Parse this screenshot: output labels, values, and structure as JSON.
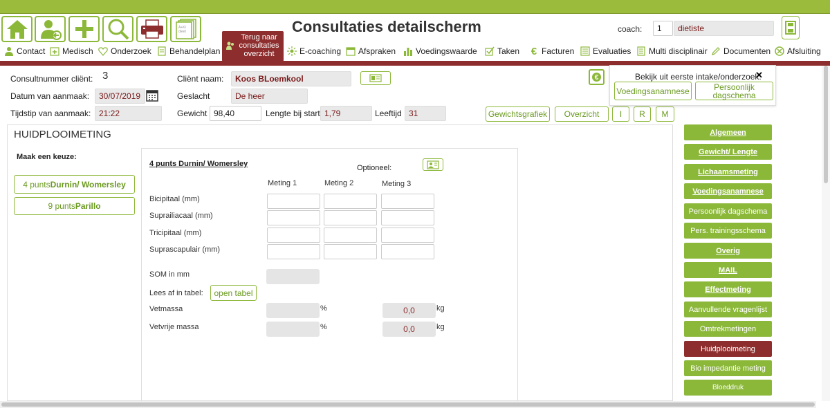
{
  "header": {
    "title": "Consultaties detailscherm",
    "coach_label": "coach:",
    "coach_id": "1",
    "coach_name": "dietiste",
    "print_card_text": "A+Kl dieet"
  },
  "nav": {
    "items": [
      {
        "label": "Contact",
        "icon": "person-icon"
      },
      {
        "label": "Medisch",
        "icon": "medical-icon"
      },
      {
        "label": "Onderzoek",
        "icon": "heart-icon"
      },
      {
        "label": "Behandelplan",
        "icon": "clipboard-icon"
      },
      {
        "label": "E-coaching",
        "icon": "sun-icon"
      },
      {
        "label": "Afspraken",
        "icon": "calendar-icon"
      },
      {
        "label": "Voedingswaarde",
        "icon": "bar-chart-icon"
      },
      {
        "label": "Taken",
        "icon": "checkbox-icon"
      },
      {
        "label": "Facturen",
        "icon": "euro-icon"
      },
      {
        "label": "Evaluaties",
        "icon": "list-icon"
      },
      {
        "label": "Multi disciplinair",
        "icon": "document-icon"
      },
      {
        "label": "Documenten",
        "icon": "pencil-icon"
      },
      {
        "label": "Afsluiting",
        "icon": "close-circle-icon"
      }
    ],
    "terug_line1": "Terug naar",
    "terug_line2": "consultaties",
    "terug_line3": "overzicht"
  },
  "client": {
    "consult_label": "Consultnummer cliënt:",
    "consult_value": "3",
    "datum_label": "Datum van aanmaak:",
    "datum_value": "30/07/2019",
    "tijd_label": "Tijdstip van aanmaak:",
    "tijd_value": "21:22",
    "naam_label": "Cliënt naam:",
    "naam_value": "Koos BLoemkool",
    "geslacht_label": "Geslacht",
    "geslacht_value": "De heer",
    "gewicht_label": "Gewicht",
    "gewicht_value": "98,40",
    "lengte_label": "Lengte bij start:",
    "lengte_value": "1,79",
    "leeftijd_label": "Leeftijd",
    "leeftijd_value": "31"
  },
  "buttons": {
    "gewichtsgrafiek": "Gewichtsgrafiek",
    "overzicht": "Overzicht",
    "i": "I",
    "r": "R",
    "m": "M"
  },
  "intake_popup": {
    "title": "Bekijk uit eerste intake/onderzoek:",
    "close": "✕",
    "btn1": "Voedingsanamnese",
    "btn2_line1": "Persoonlijk",
    "btn2_line2": "dagschema"
  },
  "section": {
    "title": "HUIDPLOOIMETING",
    "choose_label": "Maak een keuze:",
    "option1_prefix": "4 punts ",
    "option1_bold": "Durnin/ Womersley",
    "option2_prefix": "9 punts ",
    "option2_bold": "Parillo"
  },
  "form": {
    "heading": "4 punts Durnin/ Womersley",
    "optioneel": "Optioneel:",
    "col1": "Meting 1",
    "col2": "Meting 2",
    "col3": "Meting 3",
    "rows": [
      "Bicipitaal (mm)",
      "Suprailiacaal (mm)",
      "Tricipitaal (mm)",
      "Suprascapulair (mm)"
    ],
    "som_label": "SOM in mm",
    "lees_label": "Lees af in tabel:",
    "open_tabel": "open tabel",
    "vetmassa_label": "Vetmassa",
    "vetvrije_label": "Vetvrije massa",
    "pct": "%",
    "kg": "kg",
    "vetmassa_kg": "0,0",
    "vetvrije_kg": "0,0"
  },
  "sidebar": {
    "items": [
      {
        "label": "Algemeen",
        "style": "bold"
      },
      {
        "label": "Gewicht/ Lengte",
        "style": "bold"
      },
      {
        "label": "Lichaamsmeting",
        "style": "bold"
      },
      {
        "label": "Voedingsanamnese",
        "style": "bold"
      },
      {
        "label": "Persoonlijk dagschema",
        "style": "normal"
      },
      {
        "label": "Pers. trainingsschema",
        "style": "normal"
      },
      {
        "label": "Overig",
        "style": "bold"
      },
      {
        "label": "MAIL",
        "style": "bold"
      },
      {
        "label": "Effectmeting",
        "style": "bold"
      },
      {
        "label": "Aanvullende vragenlijst",
        "style": "normal"
      },
      {
        "label": "Omtrekmetingen",
        "style": "normal"
      },
      {
        "label": "Huidplooimeting",
        "style": "active"
      },
      {
        "label": "Bio impedantie meting",
        "style": "normal"
      },
      {
        "label": "Bloeddruk",
        "style": "normal"
      }
    ]
  },
  "colors": {
    "accent_green": "#8cb83a",
    "dark_red": "#8e2d2d"
  }
}
